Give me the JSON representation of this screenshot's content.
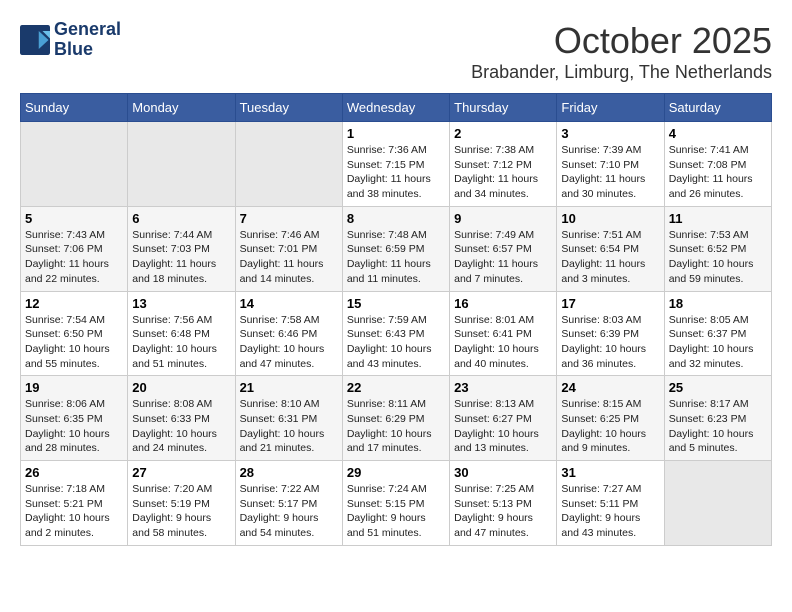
{
  "header": {
    "logo_line1": "General",
    "logo_line2": "Blue",
    "month": "October 2025",
    "location": "Brabander, Limburg, The Netherlands"
  },
  "weekdays": [
    "Sunday",
    "Monday",
    "Tuesday",
    "Wednesday",
    "Thursday",
    "Friday",
    "Saturday"
  ],
  "weeks": [
    [
      {
        "day": "",
        "info": ""
      },
      {
        "day": "",
        "info": ""
      },
      {
        "day": "",
        "info": ""
      },
      {
        "day": "1",
        "info": "Sunrise: 7:36 AM\nSunset: 7:15 PM\nDaylight: 11 hours\nand 38 minutes."
      },
      {
        "day": "2",
        "info": "Sunrise: 7:38 AM\nSunset: 7:12 PM\nDaylight: 11 hours\nand 34 minutes."
      },
      {
        "day": "3",
        "info": "Sunrise: 7:39 AM\nSunset: 7:10 PM\nDaylight: 11 hours\nand 30 minutes."
      },
      {
        "day": "4",
        "info": "Sunrise: 7:41 AM\nSunset: 7:08 PM\nDaylight: 11 hours\nand 26 minutes."
      }
    ],
    [
      {
        "day": "5",
        "info": "Sunrise: 7:43 AM\nSunset: 7:06 PM\nDaylight: 11 hours\nand 22 minutes."
      },
      {
        "day": "6",
        "info": "Sunrise: 7:44 AM\nSunset: 7:03 PM\nDaylight: 11 hours\nand 18 minutes."
      },
      {
        "day": "7",
        "info": "Sunrise: 7:46 AM\nSunset: 7:01 PM\nDaylight: 11 hours\nand 14 minutes."
      },
      {
        "day": "8",
        "info": "Sunrise: 7:48 AM\nSunset: 6:59 PM\nDaylight: 11 hours\nand 11 minutes."
      },
      {
        "day": "9",
        "info": "Sunrise: 7:49 AM\nSunset: 6:57 PM\nDaylight: 11 hours\nand 7 minutes."
      },
      {
        "day": "10",
        "info": "Sunrise: 7:51 AM\nSunset: 6:54 PM\nDaylight: 11 hours\nand 3 minutes."
      },
      {
        "day": "11",
        "info": "Sunrise: 7:53 AM\nSunset: 6:52 PM\nDaylight: 10 hours\nand 59 minutes."
      }
    ],
    [
      {
        "day": "12",
        "info": "Sunrise: 7:54 AM\nSunset: 6:50 PM\nDaylight: 10 hours\nand 55 minutes."
      },
      {
        "day": "13",
        "info": "Sunrise: 7:56 AM\nSunset: 6:48 PM\nDaylight: 10 hours\nand 51 minutes."
      },
      {
        "day": "14",
        "info": "Sunrise: 7:58 AM\nSunset: 6:46 PM\nDaylight: 10 hours\nand 47 minutes."
      },
      {
        "day": "15",
        "info": "Sunrise: 7:59 AM\nSunset: 6:43 PM\nDaylight: 10 hours\nand 43 minutes."
      },
      {
        "day": "16",
        "info": "Sunrise: 8:01 AM\nSunset: 6:41 PM\nDaylight: 10 hours\nand 40 minutes."
      },
      {
        "day": "17",
        "info": "Sunrise: 8:03 AM\nSunset: 6:39 PM\nDaylight: 10 hours\nand 36 minutes."
      },
      {
        "day": "18",
        "info": "Sunrise: 8:05 AM\nSunset: 6:37 PM\nDaylight: 10 hours\nand 32 minutes."
      }
    ],
    [
      {
        "day": "19",
        "info": "Sunrise: 8:06 AM\nSunset: 6:35 PM\nDaylight: 10 hours\nand 28 minutes."
      },
      {
        "day": "20",
        "info": "Sunrise: 8:08 AM\nSunset: 6:33 PM\nDaylight: 10 hours\nand 24 minutes."
      },
      {
        "day": "21",
        "info": "Sunrise: 8:10 AM\nSunset: 6:31 PM\nDaylight: 10 hours\nand 21 minutes."
      },
      {
        "day": "22",
        "info": "Sunrise: 8:11 AM\nSunset: 6:29 PM\nDaylight: 10 hours\nand 17 minutes."
      },
      {
        "day": "23",
        "info": "Sunrise: 8:13 AM\nSunset: 6:27 PM\nDaylight: 10 hours\nand 13 minutes."
      },
      {
        "day": "24",
        "info": "Sunrise: 8:15 AM\nSunset: 6:25 PM\nDaylight: 10 hours\nand 9 minutes."
      },
      {
        "day": "25",
        "info": "Sunrise: 8:17 AM\nSunset: 6:23 PM\nDaylight: 10 hours\nand 5 minutes."
      }
    ],
    [
      {
        "day": "26",
        "info": "Sunrise: 7:18 AM\nSunset: 5:21 PM\nDaylight: 10 hours\nand 2 minutes."
      },
      {
        "day": "27",
        "info": "Sunrise: 7:20 AM\nSunset: 5:19 PM\nDaylight: 9 hours\nand 58 minutes."
      },
      {
        "day": "28",
        "info": "Sunrise: 7:22 AM\nSunset: 5:17 PM\nDaylight: 9 hours\nand 54 minutes."
      },
      {
        "day": "29",
        "info": "Sunrise: 7:24 AM\nSunset: 5:15 PM\nDaylight: 9 hours\nand 51 minutes."
      },
      {
        "day": "30",
        "info": "Sunrise: 7:25 AM\nSunset: 5:13 PM\nDaylight: 9 hours\nand 47 minutes."
      },
      {
        "day": "31",
        "info": "Sunrise: 7:27 AM\nSunset: 5:11 PM\nDaylight: 9 hours\nand 43 minutes."
      },
      {
        "day": "",
        "info": ""
      }
    ]
  ]
}
